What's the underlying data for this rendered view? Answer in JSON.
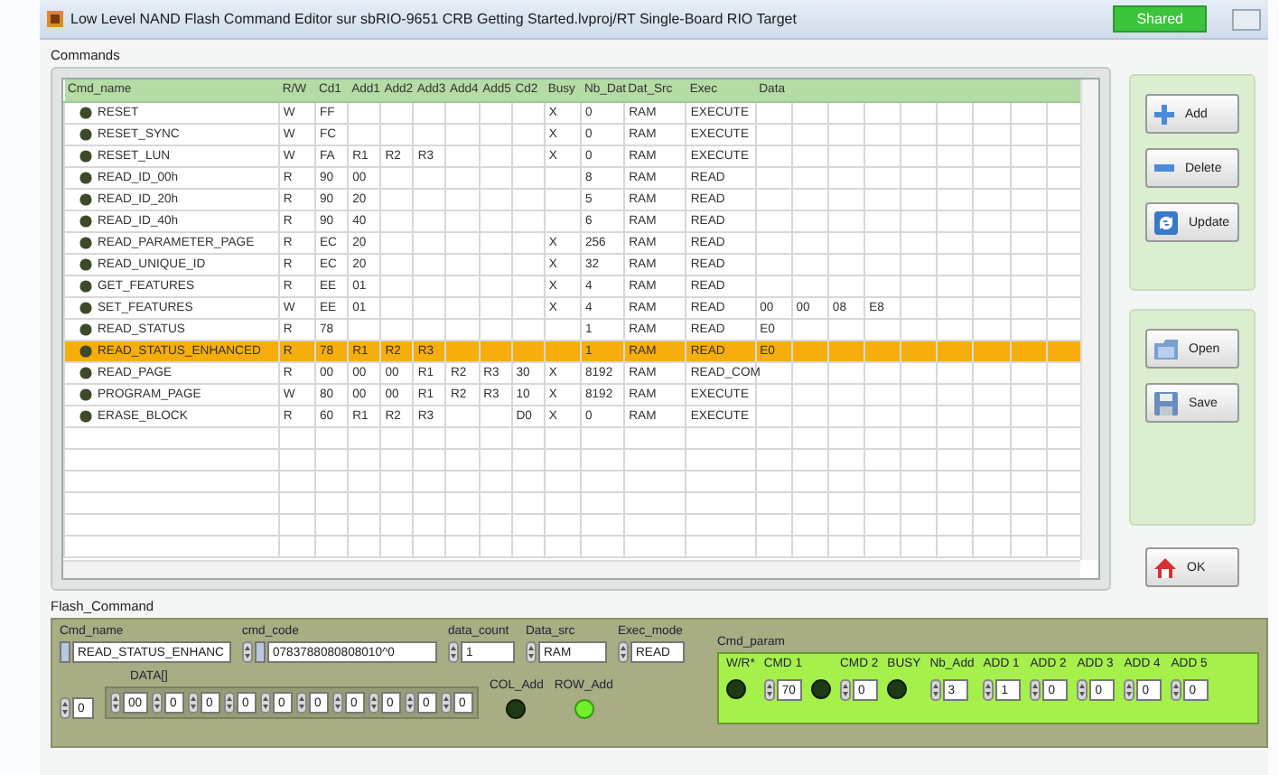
{
  "window": {
    "title": "Low Level NAND Flash Command Editor sur sbRIO-9651 CRB Getting Started.lvproj/RT Single-Board RIO Target",
    "badge": "Shared"
  },
  "commands": {
    "label": "Commands",
    "columns": [
      "Cmd_name",
      "R/W",
      "Cd1",
      "Add1",
      "Add2",
      "Add3",
      "Add4",
      "Add5",
      "Cd2",
      "Busy",
      "Nb_Dat",
      "Dat_Src",
      "Exec",
      "Data"
    ],
    "rows": [
      {
        "name": "RESET",
        "rw": "W",
        "cd1": "FF",
        "busy": "X",
        "nb_dat": "0",
        "dat_src": "RAM",
        "exec": "EXECUTE",
        "selected": false
      },
      {
        "name": "RESET_SYNC",
        "rw": "W",
        "cd1": "FC",
        "busy": "X",
        "nb_dat": "0",
        "dat_src": "RAM",
        "exec": "EXECUTE",
        "selected": false
      },
      {
        "name": "RESET_LUN",
        "rw": "W",
        "cd1": "FA",
        "add1": "R1",
        "add2": "R2",
        "add3": "R3",
        "busy": "X",
        "nb_dat": "0",
        "dat_src": "RAM",
        "exec": "EXECUTE",
        "selected": false
      },
      {
        "name": "READ_ID_00h",
        "rw": "R",
        "cd1": "90",
        "add1": "00",
        "nb_dat": "8",
        "dat_src": "RAM",
        "exec": "READ",
        "selected": false
      },
      {
        "name": "READ_ID_20h",
        "rw": "R",
        "cd1": "90",
        "add1": "20",
        "nb_dat": "5",
        "dat_src": "RAM",
        "exec": "READ",
        "selected": false
      },
      {
        "name": "READ_ID_40h",
        "rw": "R",
        "cd1": "90",
        "add1": "40",
        "nb_dat": "6",
        "dat_src": "RAM",
        "exec": "READ",
        "selected": false
      },
      {
        "name": "READ_PARAMETER_PAGE",
        "rw": "R",
        "cd1": "EC",
        "add1": "20",
        "busy": "X",
        "nb_dat": "256",
        "dat_src": "RAM",
        "exec": "READ",
        "selected": false
      },
      {
        "name": "READ_UNIQUE_ID",
        "rw": "R",
        "cd1": "EC",
        "add1": "20",
        "busy": "X",
        "nb_dat": "32",
        "dat_src": "RAM",
        "exec": "READ",
        "selected": false
      },
      {
        "name": "GET_FEATURES",
        "rw": "R",
        "cd1": "EE",
        "add1": "01",
        "busy": "X",
        "nb_dat": "4",
        "dat_src": "RAM",
        "exec": "READ",
        "selected": false
      },
      {
        "name": "SET_FEATURES",
        "rw": "W",
        "cd1": "EE",
        "add1": "01",
        "busy": "X",
        "nb_dat": "4",
        "dat_src": "RAM",
        "exec": "READ",
        "data": [
          "00",
          "00",
          "08",
          "E8"
        ],
        "selected": false
      },
      {
        "name": "READ_STATUS",
        "rw": "R",
        "cd1": "78",
        "nb_dat": "1",
        "dat_src": "RAM",
        "exec": "READ",
        "data": [
          "E0"
        ],
        "selected": false
      },
      {
        "name": "READ_STATUS_ENHANCED",
        "rw": "R",
        "cd1": "78",
        "add1": "R1",
        "add2": "R2",
        "add3": "R3",
        "nb_dat": "1",
        "dat_src": "RAM",
        "exec": "READ",
        "data": [
          "E0"
        ],
        "selected": true
      },
      {
        "name": "READ_PAGE",
        "rw": "R",
        "cd1": "00",
        "add1": "00",
        "add2": "00",
        "add3": "R1",
        "add4": "R2",
        "add5": "R3",
        "cd2": "30",
        "busy": "X",
        "nb_dat": "8192",
        "dat_src": "RAM",
        "exec": "READ_COM",
        "selected": false
      },
      {
        "name": "PROGRAM_PAGE",
        "rw": "W",
        "cd1": "80",
        "add1": "00",
        "add2": "00",
        "add3": "R1",
        "add4": "R2",
        "add5": "R3",
        "cd2": "10",
        "busy": "X",
        "nb_dat": "8192",
        "dat_src": "RAM",
        "exec": "EXECUTE",
        "selected": false
      },
      {
        "name": "ERASE_BLOCK",
        "rw": "R",
        "cd1": "60",
        "add1": "R1",
        "add2": "R2",
        "add3": "R3",
        "cd2": "D0",
        "busy": "X",
        "nb_dat": "0",
        "dat_src": "RAM",
        "exec": "EXECUTE",
        "selected": false
      }
    ]
  },
  "edit_buttons": [
    {
      "label": "Add",
      "kind": "add"
    },
    {
      "label": "Delete",
      "kind": "delete"
    },
    {
      "label": "Update",
      "kind": "update"
    }
  ],
  "file_buttons": [
    {
      "label": "Open",
      "kind": "open"
    },
    {
      "label": "Save",
      "kind": "save"
    }
  ],
  "ok_button": {
    "label": "OK"
  },
  "flash_command": {
    "label": "Flash_Command",
    "cmd_name": {
      "label": "Cmd_name",
      "value": "READ_STATUS_ENHANC"
    },
    "cmd_code": {
      "label": "cmd_code",
      "value": "0783788080808010^0"
    },
    "data_count": {
      "label": "data_count",
      "value": "1"
    },
    "data_src": {
      "label": "Data_src",
      "value": "RAM"
    },
    "exec_mode": {
      "label": "Exec_mode",
      "value": "READ"
    },
    "data": {
      "label": "DATA[]",
      "index": "0",
      "values": [
        "00",
        "0",
        "0",
        "0",
        "0",
        "0",
        "0",
        "0",
        "0",
        "0"
      ]
    },
    "col_add": {
      "label": "COL_Add",
      "on": false
    },
    "row_add": {
      "label": "ROW_Add",
      "on": true
    },
    "cmd_param": {
      "label": "Cmd_param",
      "items": [
        {
          "kind": "led",
          "label": "W/R*",
          "on": false
        },
        {
          "kind": "numeric",
          "label": "CMD 1",
          "value": "70"
        },
        {
          "kind": "led",
          "on": false
        },
        {
          "kind": "numeric",
          "label": "CMD 2",
          "value": "0"
        },
        {
          "kind": "led",
          "label": "BUSY",
          "on": false
        },
        {
          "kind": "numeric",
          "label": "Nb_Add",
          "value": "3"
        },
        {
          "kind": "numeric",
          "label": "ADD 1",
          "value": "1"
        },
        {
          "kind": "numeric",
          "label": "ADD 2",
          "value": "0"
        },
        {
          "kind": "numeric",
          "label": "ADD 3",
          "value": "0"
        },
        {
          "kind": "numeric",
          "label": "ADD 4",
          "value": "0"
        },
        {
          "kind": "numeric",
          "label": "ADD 5",
          "value": "0"
        }
      ]
    }
  }
}
